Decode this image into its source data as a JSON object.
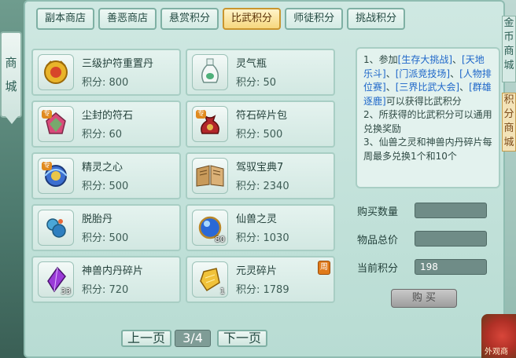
{
  "side": {
    "left_tab": [
      "商",
      "城"
    ],
    "right_top": "金币商城",
    "right_mid": "积分商城",
    "bottom_right": "外观商"
  },
  "tabs": [
    "副本商店",
    "善恶商店",
    "悬赏积分",
    "比武积分",
    "师徒积分",
    "挑战积分"
  ],
  "active_tab": 3,
  "items": [
    {
      "name": "三级护符重置丹",
      "price": "积分: 800",
      "icon": "gold-charm-icon"
    },
    {
      "name": "灵气瓶",
      "price": "积分: 50",
      "icon": "vase-icon"
    },
    {
      "name": "尘封的符石",
      "price": "积分: 60",
      "icon": "gem-icon",
      "tag": "专"
    },
    {
      "name": "符石碎片包",
      "price": "积分: 500",
      "icon": "pouch-icon",
      "tag": "专"
    },
    {
      "name": "精灵之心",
      "price": "积分: 500",
      "icon": "spirit-heart-icon",
      "tag": "专"
    },
    {
      "name": "驾驭宝典7",
      "price": "积分: 2340",
      "icon": "book-icon"
    },
    {
      "name": "脱胎丹",
      "price": "积分: 500",
      "icon": "pill-icon"
    },
    {
      "name": "仙兽之灵",
      "price": "积分: 1030",
      "icon": "orb-icon",
      "count": "80"
    },
    {
      "name": "神兽内丹碎片",
      "price": "积分: 720",
      "icon": "crystal-icon",
      "count": "33"
    },
    {
      "name": "元灵碎片",
      "price": "积分: 1789",
      "icon": "gold-shard-icon",
      "count": "1",
      "week": "周"
    }
  ],
  "info": {
    "line1_pre": "1、参加",
    "link1": "[生存大挑战]",
    "sep1": "、",
    "link2": "[天地乐斗]",
    "sep2": "、",
    "link3": "[门派竞技场]",
    "sep3": "、",
    "link4": "[人物排位赛]",
    "sep4": "、",
    "link5": "[三界比武大会]",
    "sep5": "、",
    "link6": "[群雄逐鹿]",
    "line1_post": "可以获得比武积分",
    "line2": "2、所获得的比武积分可以通用兑换奖励",
    "line3": "3、仙兽之灵和神兽内丹碎片每周最多兑换1个和10个"
  },
  "form": {
    "qty_label": "购买数量",
    "qty_value": "",
    "total_label": "物品总价",
    "total_value": "",
    "points_label": "当前积分",
    "points_value": "198",
    "buy_label": "购 买"
  },
  "pager": {
    "prev": "上一页",
    "page": "3/4",
    "next": "下一页"
  }
}
